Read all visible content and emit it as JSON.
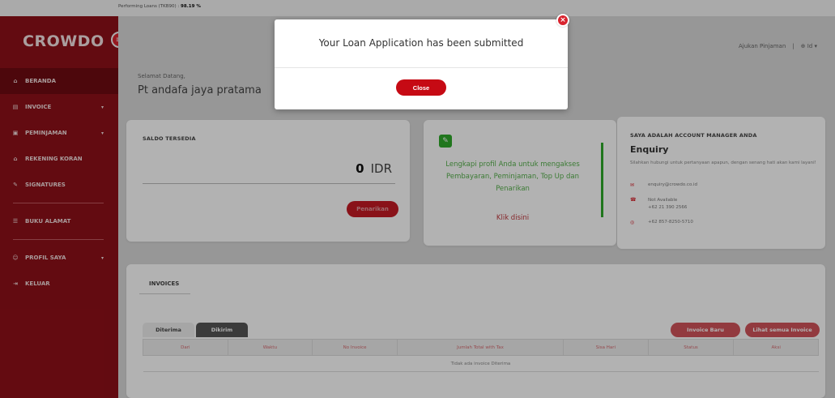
{
  "topbar": {
    "label": "Performing Loans (TKB90) :",
    "value": "98.19 %"
  },
  "brand": {
    "name": "CROWDO",
    "menu_icon": "≡"
  },
  "sidebar": {
    "items": [
      {
        "icon": "⌂",
        "label": "BERANDA"
      },
      {
        "icon": "▤",
        "label": "INVOICE",
        "caret": "▾"
      },
      {
        "icon": "▣",
        "label": "PEMINJAMAN",
        "caret": "▾"
      },
      {
        "icon": "⌂",
        "label": "REKENING KORAN"
      },
      {
        "icon": "✎",
        "label": "SIGNATURES"
      },
      {
        "icon": "☰",
        "label": "BUKU ALAMAT"
      },
      {
        "icon": "☺",
        "label": "PROFIL SAYA",
        "caret": "▾"
      },
      {
        "icon": "⇥",
        "label": "KELUAR"
      }
    ]
  },
  "header": {
    "apply_loan": "Ajukan Pinjaman",
    "separator": "|",
    "language": "Id",
    "globe_icon": "⊕",
    "caret": "▾"
  },
  "welcome": {
    "greeting": "Selamat Datang,",
    "company": "Pt andafa jaya pratama"
  },
  "saldo": {
    "title": "SALDO TERSEDIA",
    "amount": "0",
    "currency": "IDR",
    "withdraw_label": "Penarikan"
  },
  "profil": {
    "icon": "✎",
    "message": "Lengkapi profil Anda untuk mengakses Pembayaran, Peminjaman, Top Up dan Penarikan",
    "link": "Klik disini"
  },
  "account_manager": {
    "title": "SAYA ADALAH ACCOUNT MANAGER ANDA",
    "name": "Enquiry",
    "description": "Silahkan hubungi untuk pertanyaan apapun, dengan senang hati akan kami layani!",
    "email": "enquiry@crowdo.co.id",
    "phone_status": "Not Available",
    "phone": "+62 21 390 2566",
    "whatsapp": "+62 857-8250-5710",
    "email_icon": "✉",
    "phone_icon": "☎",
    "whatsapp_icon": "◎"
  },
  "invoices": {
    "tab_title": "INVOICES",
    "subtab_received": "Diterima",
    "subtab_sent": "Dikirim",
    "new_invoice": "Invoice Baru",
    "view_all": "Lihat semua Invoice",
    "columns": [
      "Dari",
      "Waktu",
      "No Invoice",
      "Jumlah Total with Tax",
      "Sisa Hari",
      "Status",
      "Aksi"
    ],
    "empty_message": "Tidak ada invoice Diterima"
  },
  "modal": {
    "message": "Your Loan Application has been submitted",
    "close_label": "Close",
    "x_icon": "×"
  }
}
